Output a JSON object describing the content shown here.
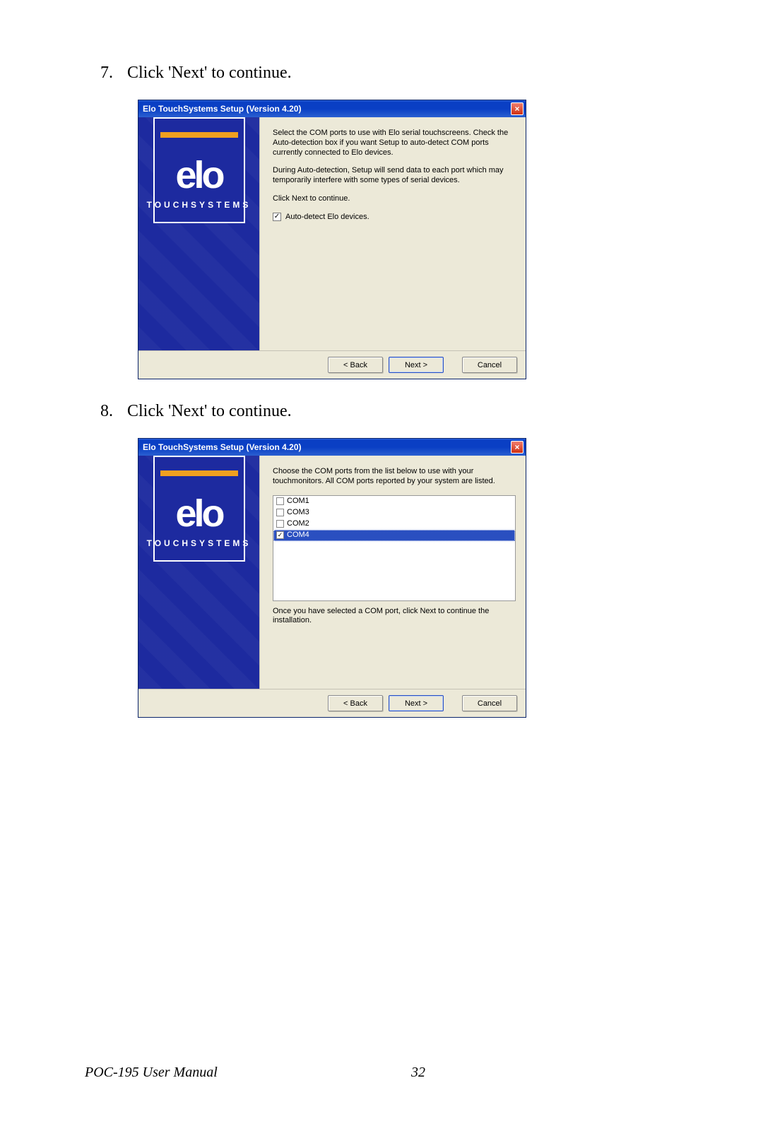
{
  "steps": {
    "s7": {
      "num": "7.",
      "text": "Click 'Next' to continue."
    },
    "s8": {
      "num": "8.",
      "text": "Click 'Next' to continue."
    }
  },
  "dialog1": {
    "title": "Elo TouchSystems Setup (Version 4.20)",
    "logo_word": "elo",
    "logo_sub": "TOUCHSYSTEMS",
    "p1": "Select the COM ports to use with Elo serial touchscreens. Check the Auto-detection box if you want Setup to auto-detect COM ports currently connected to Elo devices.",
    "p2": "During Auto-detection, Setup will send data to each port which may temporarily interfere with some types of serial devices.",
    "p3": "Click Next to continue.",
    "checkbox_label": "Auto-detect Elo devices.",
    "back": "< Back",
    "next": "Next >",
    "cancel": "Cancel"
  },
  "dialog2": {
    "title": "Elo TouchSystems Setup (Version 4.20)",
    "logo_word": "elo",
    "logo_sub": "TOUCHSYSTEMS",
    "p1": "Choose the COM ports from the list below to use with your touchmonitors. All COM ports reported by your system are listed.",
    "items": {
      "i0": "COM1",
      "i1": "COM3",
      "i2": "COM2",
      "i3": "COM4"
    },
    "p2": "Once you have selected a COM port, click Next to continue the installation.",
    "back": "< Back",
    "next": "Next >",
    "cancel": "Cancel"
  },
  "footer": {
    "doc": "POC-195 User Manual",
    "page": "32"
  }
}
